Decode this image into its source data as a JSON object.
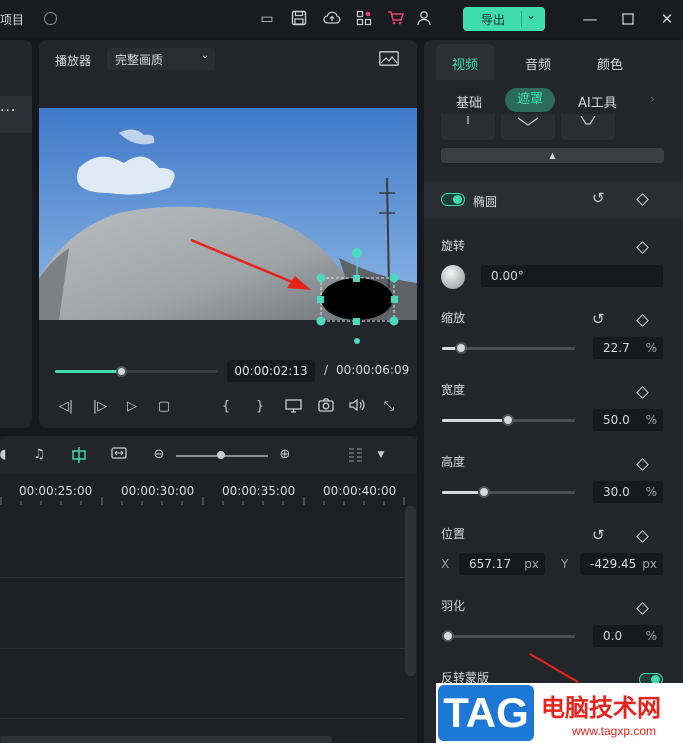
{
  "titlebar": {
    "project_label": "项目",
    "export_label": "导出"
  },
  "player": {
    "label": "播放器",
    "quality": "完整画质",
    "current_time": "00:00:02:13",
    "separator": "/",
    "total_time": "00:00:06:09",
    "progress": 0.4
  },
  "timeline": {
    "ticks": [
      "00:00:25:00",
      "00:00:30:00",
      "00:00:35:00",
      "00:00:40:00"
    ],
    "zoom_level": 0.5
  },
  "panel": {
    "tabs": [
      "视频",
      "音频",
      "颜色"
    ],
    "active_tab": "视频",
    "subtabs": [
      "基础",
      "遮罩",
      "AI工具"
    ],
    "active_subtab": "遮罩",
    "mask_name": "椭圆",
    "mask_enabled": true,
    "rotation": {
      "label": "旋转",
      "value": "0.00°"
    },
    "scale": {
      "label": "缩放",
      "value": "22.7",
      "unit": "%",
      "level": 22.7
    },
    "width": {
      "label": "宽度",
      "value": "50.0",
      "unit": "%",
      "level": 50.0
    },
    "height": {
      "label": "高度",
      "value": "30.0",
      "unit": "%",
      "level": 30.0
    },
    "position": {
      "label": "位置",
      "x_label": "X",
      "x_value": "657.17",
      "y_label": "Y",
      "y_value": "-429.45",
      "unit": "px"
    },
    "feather": {
      "label": "羽化",
      "value": "0.0",
      "unit": "%",
      "level": 0
    },
    "invert": {
      "label": "反转蒙版",
      "enabled": true
    }
  },
  "watermark": {
    "logo": "TAG",
    "site_name": "电脑技术网",
    "url": "www.tagxp.com"
  },
  "colors": {
    "accent": "#3fdcb0",
    "panel": "#22262b",
    "annotation_arrow": "#e8231b"
  }
}
